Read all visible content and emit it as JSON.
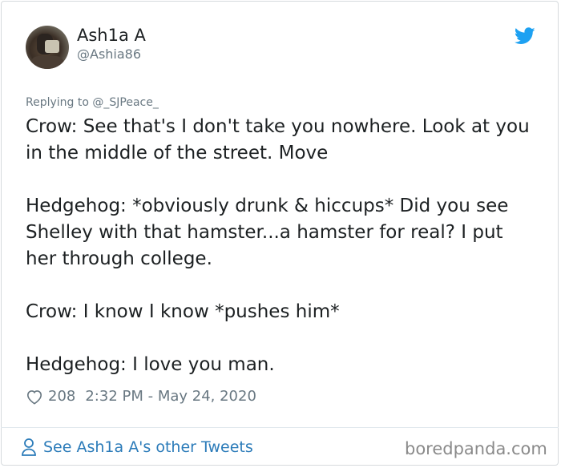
{
  "author": {
    "display_name": "Ash1a A",
    "handle": "@Ashia86"
  },
  "replying_to": "Replying to @_SJPeace_",
  "tweet_paragraphs": [
    "Crow: See that's I don't take you nowhere. Look at you in the middle of the street. Move",
    "Hedgehog: *obviously drunk & hiccups* Did you see Shelley with that hamster...a hamster for real? I put her through college.",
    "Crow: I know I know *pushes him*",
    "Hedgehog: I love you man."
  ],
  "meta": {
    "likes": "208",
    "timestamp": "2:32 PM - May 24, 2020"
  },
  "footer": {
    "other_tweets_link": "See Ash1a A's other Tweets"
  },
  "watermark": "boredpanda.com",
  "icons": {
    "brand": "twitter-bird-icon",
    "like": "heart-icon",
    "profile": "person-icon"
  },
  "colors": {
    "twitter_blue": "#1da1f2",
    "link_blue": "#2b7bb9",
    "secondary_text": "#697882",
    "primary_text": "#1c2022"
  }
}
